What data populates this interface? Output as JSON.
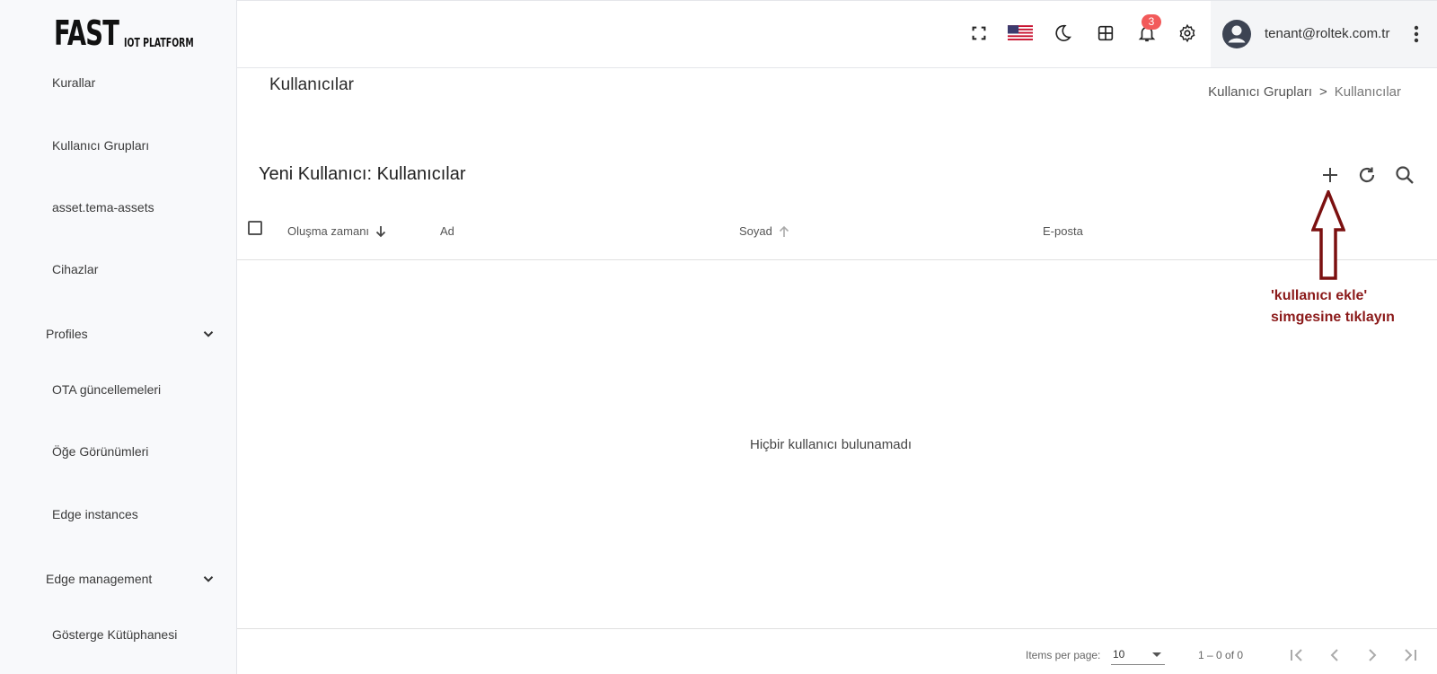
{
  "logo": {
    "big": "FAST",
    "small": "IOT PLATFORM"
  },
  "sidebar": {
    "items": [
      {
        "label": "Kurallar"
      },
      {
        "label": "Kullanıcı Grupları"
      },
      {
        "label": "asset.tema-assets"
      },
      {
        "label": "Cihazlar"
      },
      {
        "label": "Profiles",
        "expandable": true
      },
      {
        "label": "OTA güncellemeleri"
      },
      {
        "label": "Öğe Görünümleri"
      },
      {
        "label": "Edge instances"
      },
      {
        "label": "Edge management",
        "expandable": true
      },
      {
        "label": "Gösterge Kütüphanesi"
      }
    ]
  },
  "topbar": {
    "icons": [
      "fullscreen-icon",
      "us-flag-icon",
      "moon-icon",
      "apps-grid-icon",
      "bell-icon",
      "gear-icon"
    ],
    "notification_count": "3",
    "user_email": "tenant@roltek.com.tr"
  },
  "page": {
    "title": "Kullanıcılar",
    "breadcrumb": {
      "parent": "Kullanıcı Grupları",
      "separator": ">",
      "current": "Kullanıcılar"
    }
  },
  "card": {
    "title": "Yeni Kullanıcı: Kullanıcılar",
    "columns": [
      {
        "label": "Oluşma zamanı",
        "sort": "desc"
      },
      {
        "label": "Ad"
      },
      {
        "label": "Soyad",
        "sort": "asc"
      },
      {
        "label": "E-posta"
      }
    ],
    "empty_message": "Hiçbir kullanıcı bulunamadı"
  },
  "pagination": {
    "items_per_page_label": "Items per page:",
    "items_per_page_value": "10",
    "range": "1 – 0 of 0"
  },
  "annotation": {
    "line1": "'kullanıcı ekle'",
    "line2": "simgesine tıklayın",
    "color": "#7b1010"
  }
}
